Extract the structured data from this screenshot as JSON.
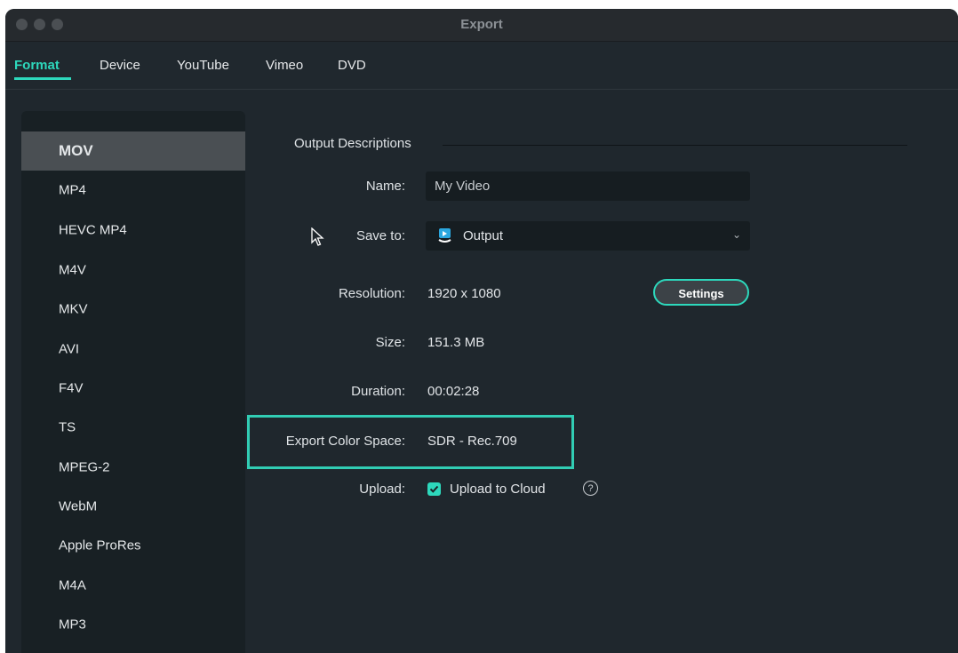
{
  "window": {
    "title": "Export"
  },
  "tabs": [
    {
      "label": "Format",
      "active": true
    },
    {
      "label": "Device"
    },
    {
      "label": "YouTube"
    },
    {
      "label": "Vimeo"
    },
    {
      "label": "DVD"
    }
  ],
  "formats": [
    "MOV",
    "MP4",
    "HEVC MP4",
    "M4V",
    "MKV",
    "AVI",
    "F4V",
    "TS",
    "MPEG-2",
    "WebM",
    "Apple ProRes",
    "M4A",
    "MP3"
  ],
  "selected_format": "MOV",
  "output": {
    "section_title": "Output Descriptions",
    "name_label": "Name:",
    "name_value": "My Video",
    "save_label": "Save to:",
    "save_value": "Output",
    "resolution_label": "Resolution:",
    "resolution_value": "1920 x 1080",
    "settings_label": "Settings",
    "size_label": "Size:",
    "size_value": "151.3 MB",
    "duration_label": "Duration:",
    "duration_value": "00:02:28",
    "color_space_label": "Export Color Space:",
    "color_space_value": "SDR - Rec.709",
    "upload_label": "Upload:",
    "upload_option": "Upload to Cloud",
    "upload_checked": true,
    "help_symbol": "?"
  },
  "colors": {
    "accent": "#2dd8bc",
    "background": "#1f272d",
    "sidebar": "#182024",
    "highlight_box": "#31cdb4"
  },
  "icons": {
    "folder": "download-folder-icon",
    "dropdown": "chevron-down-icon",
    "help": "help-circle-icon",
    "cursor": "mouse-pointer-icon"
  }
}
